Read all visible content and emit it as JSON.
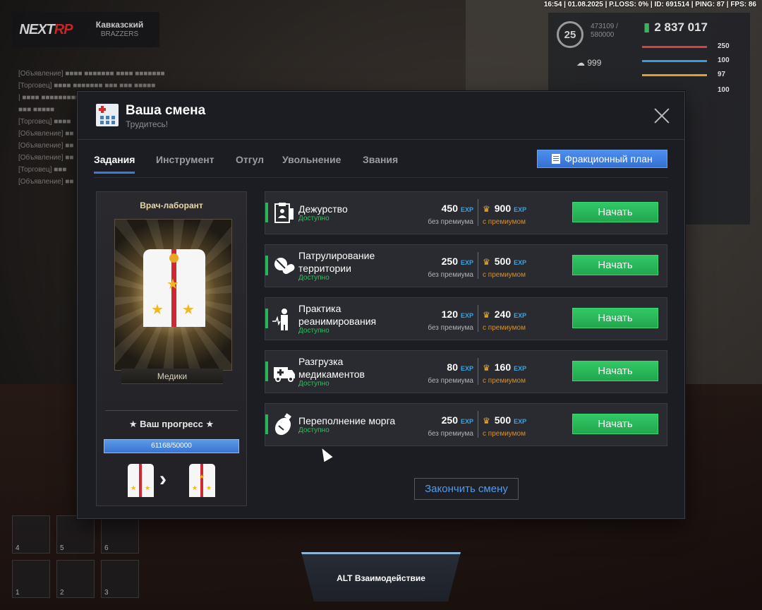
{
  "status_bar": "16:54 | 01.08.2025 | P.LOSS: 0% | ID: 691514 | PING: 87 | FPS: 86",
  "hud": {
    "logo_a": "NEXT",
    "logo_b": "RP",
    "server_name": "Кавказский",
    "server_sub": "BRAZZERS",
    "level": "25",
    "exp_line1": "473109 /",
    "exp_line2": "580000",
    "money": "2 837 017",
    "hearts": "999",
    "stats": [
      "250",
      "100",
      "97",
      "100"
    ],
    "stat_colors": [
      "#d94040",
      "#3a9ae0",
      "#e0a030",
      "#dddddd"
    ]
  },
  "hotbar": [
    "4",
    "5",
    "6",
    "1",
    "2",
    "3"
  ],
  "modal": {
    "title": "Ваша смена",
    "subtitle": "Трудитесь!",
    "tabs": [
      "Задания",
      "Инструмент",
      "Отгул",
      "Увольнение",
      "Звания"
    ],
    "plan_button": "Фракционный план",
    "rank": {
      "name": "Врач-лаборант",
      "faction": "Медики",
      "progress_title": "★ Ваш прогресс ★",
      "progress_text": "61168/50000",
      "progress_fraction": 1.0
    },
    "tasks": [
      {
        "name_l1": "Дежурство",
        "name_l2": "",
        "status": "Доступно",
        "base": "450",
        "premium": "900",
        "icon": "clipboard-doctor-icon"
      },
      {
        "name_l1": "Патрулирование",
        "name_l2": "территории",
        "status": "Доступно",
        "base": "250",
        "premium": "500",
        "icon": "pills-icon"
      },
      {
        "name_l1": "Практика",
        "name_l2": "реанимирования",
        "status": "Доступно",
        "base": "120",
        "premium": "240",
        "icon": "heartbeat-person-icon"
      },
      {
        "name_l1": "Разгрузка",
        "name_l2": "медикаментов",
        "status": "Доступно",
        "base": "80",
        "premium": "160",
        "icon": "ambulance-icon"
      },
      {
        "name_l1": "Переполнение морга",
        "name_l2": "",
        "status": "Доступно",
        "base": "250",
        "premium": "500",
        "icon": "body-bag-icon"
      }
    ],
    "exp_unit": "EXP",
    "base_label": "без премиума",
    "premium_label": "с премиумом",
    "start_label": "Начать",
    "end_button": "Закончить смену"
  },
  "interaction": "ALT Взаимодействие"
}
